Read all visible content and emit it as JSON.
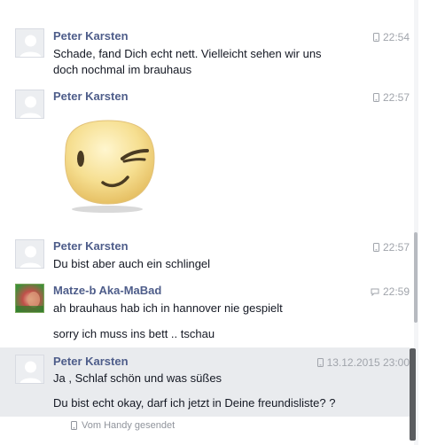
{
  "messages": [
    {
      "sender": "Peter Karsten",
      "time": "22:54",
      "lines": [
        "Schade,  fand Dich  echt  nett.  Vielleicht  sehen  wir  uns",
        "doch  nochmal  im brauhaus"
      ]
    },
    {
      "sender": "Peter Karsten",
      "time": "22:57",
      "sticker": "winking-face-sticker"
    },
    {
      "sender": "Peter Karsten",
      "time": "22:57",
      "lines": [
        "Du bist  aber  auch  ein  schlingel"
      ]
    },
    {
      "sender": "Matze-b Aka-MaBad",
      "time": "22:59",
      "lines": [
        "ah brauhaus  hab ich in hannover nie gespielt",
        "sorry ich muss ins bett .. tschau"
      ]
    },
    {
      "sender": "Peter Karsten",
      "time": "13.12.2015 23:00",
      "lines": [
        "Ja ,  Schlaf schön  und  was süßes",
        "Du bist  echt  okay,  darf ich  jetzt  in Deine freundisliste? ?"
      ]
    }
  ],
  "footer": {
    "sent_via": "Vom Handy gesendet"
  },
  "colors": {
    "sender": "#4e5d8a",
    "time": "#a0a4ab",
    "highlight_bg": "#e9ebee"
  },
  "icons": {
    "phone": "mobile-phone-icon",
    "chat": "chat-bubble-icon"
  }
}
